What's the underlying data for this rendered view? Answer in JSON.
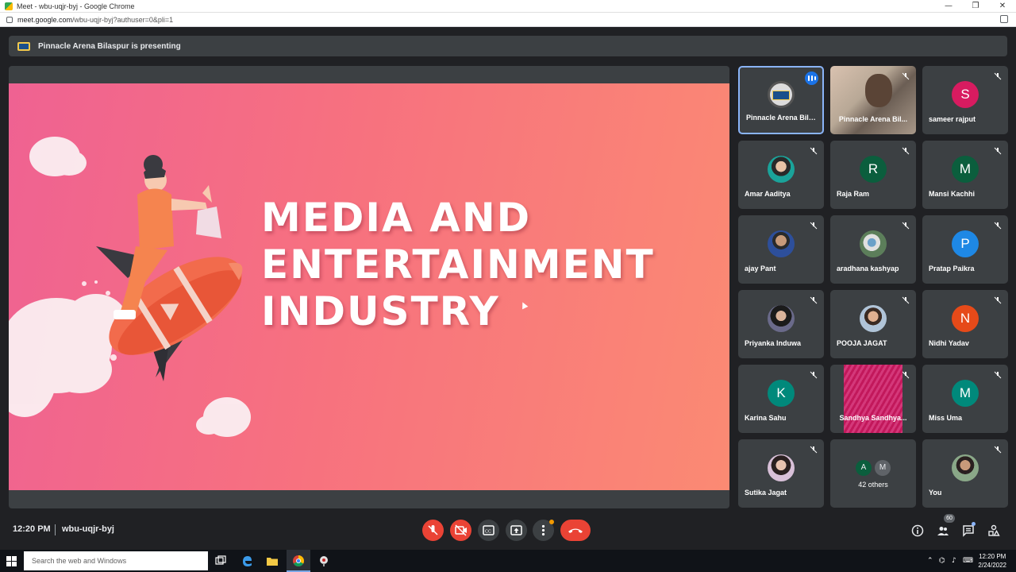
{
  "browser": {
    "window_title": "Meet - wbu-uqjr-byj - Google Chrome",
    "url_host": "meet.google.com",
    "url_path": "/wbu-uqjr-byj?authuser=0&pli=1"
  },
  "banner": {
    "text": "Pinnacle Arena Bilaspur is presenting"
  },
  "slide": {
    "line1": "MEDIA AND",
    "line2": "ENTERTAINMENT",
    "line3": "INDUSTRY"
  },
  "participants": [
    {
      "name": "Pinnacle Arena Bila...",
      "type": "logo",
      "speaking": true
    },
    {
      "name": "Pinnacle Arena Bil...",
      "type": "video"
    },
    {
      "name": "sameer rajput",
      "initial": "S",
      "color": "#d81b60"
    },
    {
      "name": "Amar Aaditya",
      "type": "photo"
    },
    {
      "name": "Raja Ram",
      "initial": "R",
      "color": "#0b5e3d"
    },
    {
      "name": "Mansi Kachhi",
      "initial": "M",
      "color": "#0b5e3d"
    },
    {
      "name": "ajay Pant",
      "type": "photo"
    },
    {
      "name": "aradhana kashyap",
      "type": "photo"
    },
    {
      "name": "Pratap Paikra",
      "initial": "P",
      "color": "#1e88e5"
    },
    {
      "name": "Priyanka Induwa",
      "type": "photo"
    },
    {
      "name": "POOJA JAGAT",
      "type": "photo"
    },
    {
      "name": "Nidhi Yadav",
      "initial": "N",
      "color": "#e64a19"
    },
    {
      "name": "Karina Sahu",
      "initial": "K",
      "color": "#00897b"
    },
    {
      "name": "Sandhya Sandhya...",
      "type": "video"
    },
    {
      "name": "Miss Uma",
      "initial": "M",
      "color": "#00897b"
    },
    {
      "name": "Sutika Jagat",
      "type": "photo"
    },
    {
      "name": "42 others",
      "type": "others",
      "initials": [
        "A",
        "M"
      ]
    },
    {
      "name": "You",
      "type": "photo"
    }
  ],
  "bottom_bar": {
    "time": "12:20 PM",
    "meeting_code": "wbu-uqjr-byj",
    "people_count": "60"
  },
  "taskbar": {
    "search_placeholder": "Search the web and Windows",
    "clock_time": "12:20 PM",
    "clock_date": "2/24/2022"
  },
  "colors": {
    "meet_bg": "#202124",
    "tile_bg": "#3c4043",
    "end_call": "#ea4335",
    "slide_gradient_start": "#ef6292",
    "slide_gradient_end": "#fb8a73"
  },
  "icons": {
    "mic_off": "mic-off-icon",
    "cam_off": "camera-off-icon",
    "captions": "captions-icon",
    "present": "present-icon",
    "more": "more-options-icon",
    "end": "end-call-icon",
    "info": "info-icon",
    "people": "people-icon",
    "chat": "chat-icon",
    "activities": "activities-icon"
  }
}
